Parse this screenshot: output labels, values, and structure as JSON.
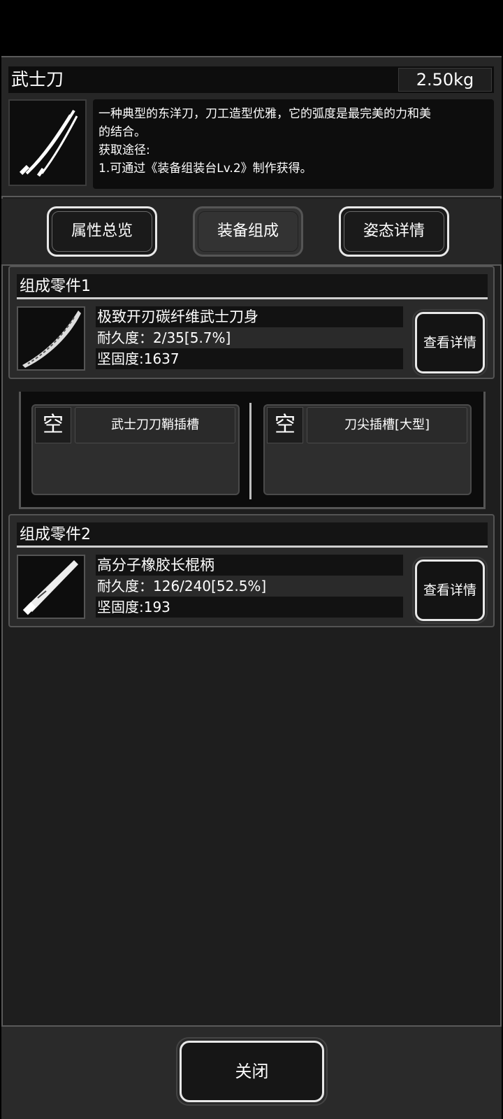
{
  "item": {
    "name": "武士刀",
    "weight": "2.50kg",
    "description": [
      "一种典型的东洋刀，刀工造型优雅，它的弧度是最完美的力和美",
      "的结合。",
      "获取途径:",
      "1.可通过《装备组装台Lv.2》制作获得。"
    ],
    "icon": "katana-icon"
  },
  "tabs": [
    {
      "label": "属性总览",
      "active": false
    },
    {
      "label": "装备组成",
      "active": true
    },
    {
      "label": "姿态详情",
      "active": false
    }
  ],
  "parts": [
    {
      "header": "组成零件1",
      "name": "极致开刃碳纤维武士刀身",
      "durability": "耐久度：2/35[5.7%]",
      "hardness": "坚固度:1637",
      "icon": "blade-icon",
      "detail_label": "查看详情"
    },
    {
      "header": "组成零件2",
      "name": "高分子橡胶长棍柄",
      "durability": "耐久度：126/240[52.5%]",
      "hardness": "坚固度:193",
      "icon": "handle-icon",
      "detail_label": "查看详情"
    }
  ],
  "slots": [
    {
      "status": "空",
      "name": "武士刀刀鞘插槽"
    },
    {
      "status": "空",
      "name": "刀尖插槽[大型]"
    }
  ],
  "footer": {
    "close_label": "关闭"
  },
  "colors": {
    "background": "#1e1e1e",
    "border": "#5a5a5a",
    "text": "#ffffff"
  }
}
